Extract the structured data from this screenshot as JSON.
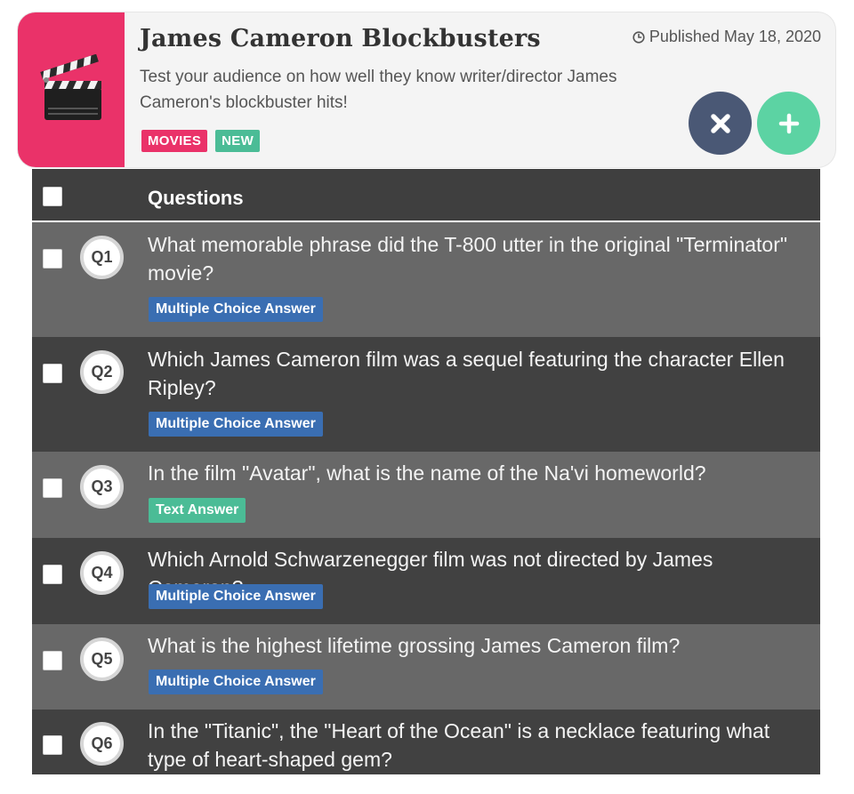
{
  "quiz": {
    "title": "James Cameron Blockbusters",
    "published": "Published May 18, 2020",
    "description": "Test your audience on how well they know writer/director James Cameron's blockbuster hits!",
    "tags": [
      "MOVIES",
      "NEW"
    ],
    "icon": "clapperboard-icon",
    "colors": {
      "thumb": "#ea3269",
      "tag_movies": "#ea3269",
      "tag_new": "#4bbc96",
      "close_button": "#4a5875",
      "add_button": "#5cd3a3"
    }
  },
  "actions": {
    "close_icon": "close-icon",
    "add_icon": "plus-icon"
  },
  "table": {
    "header": "Questions",
    "questions": [
      {
        "id": "Q1",
        "text": "What memorable phrase did the T-800 utter in the original \"Terminator\" movie?",
        "answer_type": "Multiple Choice Answer"
      },
      {
        "id": "Q2",
        "text": "Which James Cameron film was a sequel featuring the character Ellen Ripley?",
        "answer_type": "Multiple Choice Answer"
      },
      {
        "id": "Q3",
        "text": "In the film \"Avatar\", what is the name of the Na'vi homeworld?",
        "answer_type": "Text Answer"
      },
      {
        "id": "Q4",
        "text": "Which Arnold Schwarzenegger film was not directed by James Cameron?",
        "answer_type": "Multiple Choice Answer"
      },
      {
        "id": "Q5",
        "text": "What is the highest lifetime grossing James Cameron film?",
        "answer_type": "Multiple Choice Answer"
      },
      {
        "id": "Q6",
        "text": "In the \"Titanic\", the \"Heart of the Ocean\" is a necklace featuring what type of heart-shaped gem?",
        "answer_type": ""
      }
    ]
  }
}
